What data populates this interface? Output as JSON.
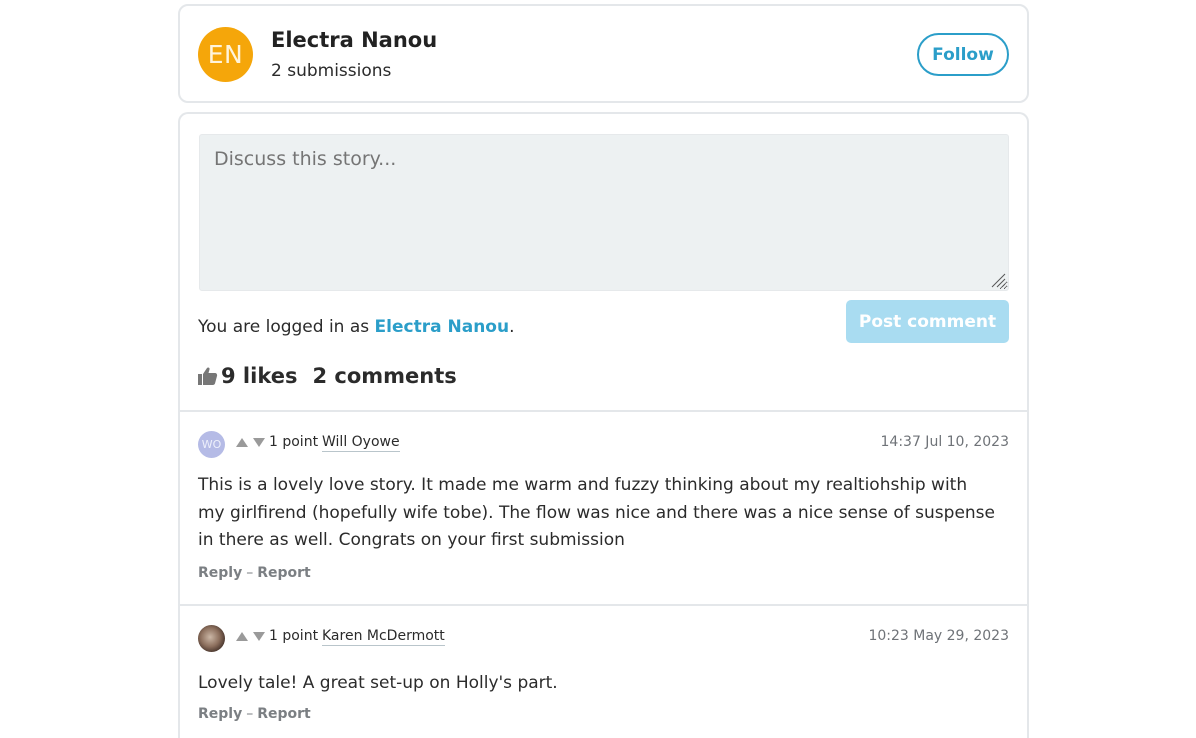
{
  "author": {
    "initials": "EN",
    "name": "Electra Nanou",
    "submissions": "2 submissions",
    "follow_label": "Follow",
    "avatar_color": "#f5a60a"
  },
  "discussion": {
    "placeholder": "Discuss this story...",
    "logged_in_prefix": "You are logged in as",
    "logged_in_user": "Electra Nanou",
    "logged_in_suffix": ".",
    "post_label": "Post comment",
    "likes": "9 likes",
    "comments": "2 comments"
  },
  "comments": [
    {
      "avatar_initials": "WO",
      "points": "1 point",
      "author": "Will Oyowe",
      "time": "14:37 Jul 10, 2023",
      "body": "This is a lovely love story. It made me warm and fuzzy thinking about my realtiohship with my girlfirend (hopefully wife tobe). The flow was nice and there was a nice sense of suspense in there as well. Congrats on your first submission",
      "reply": "Reply",
      "report": "Report"
    },
    {
      "avatar_initials": "",
      "points": "1 point",
      "author": "Karen McDermott",
      "time": "10:23 May 29, 2023",
      "body": "Lovely tale! A great set-up on Holly's part.",
      "reply": "Reply",
      "report": "Report"
    }
  ],
  "colors": {
    "accent": "#2b9ec9",
    "post_button_disabled": "#a9dcf1",
    "textarea_bg": "#edf1f2"
  }
}
